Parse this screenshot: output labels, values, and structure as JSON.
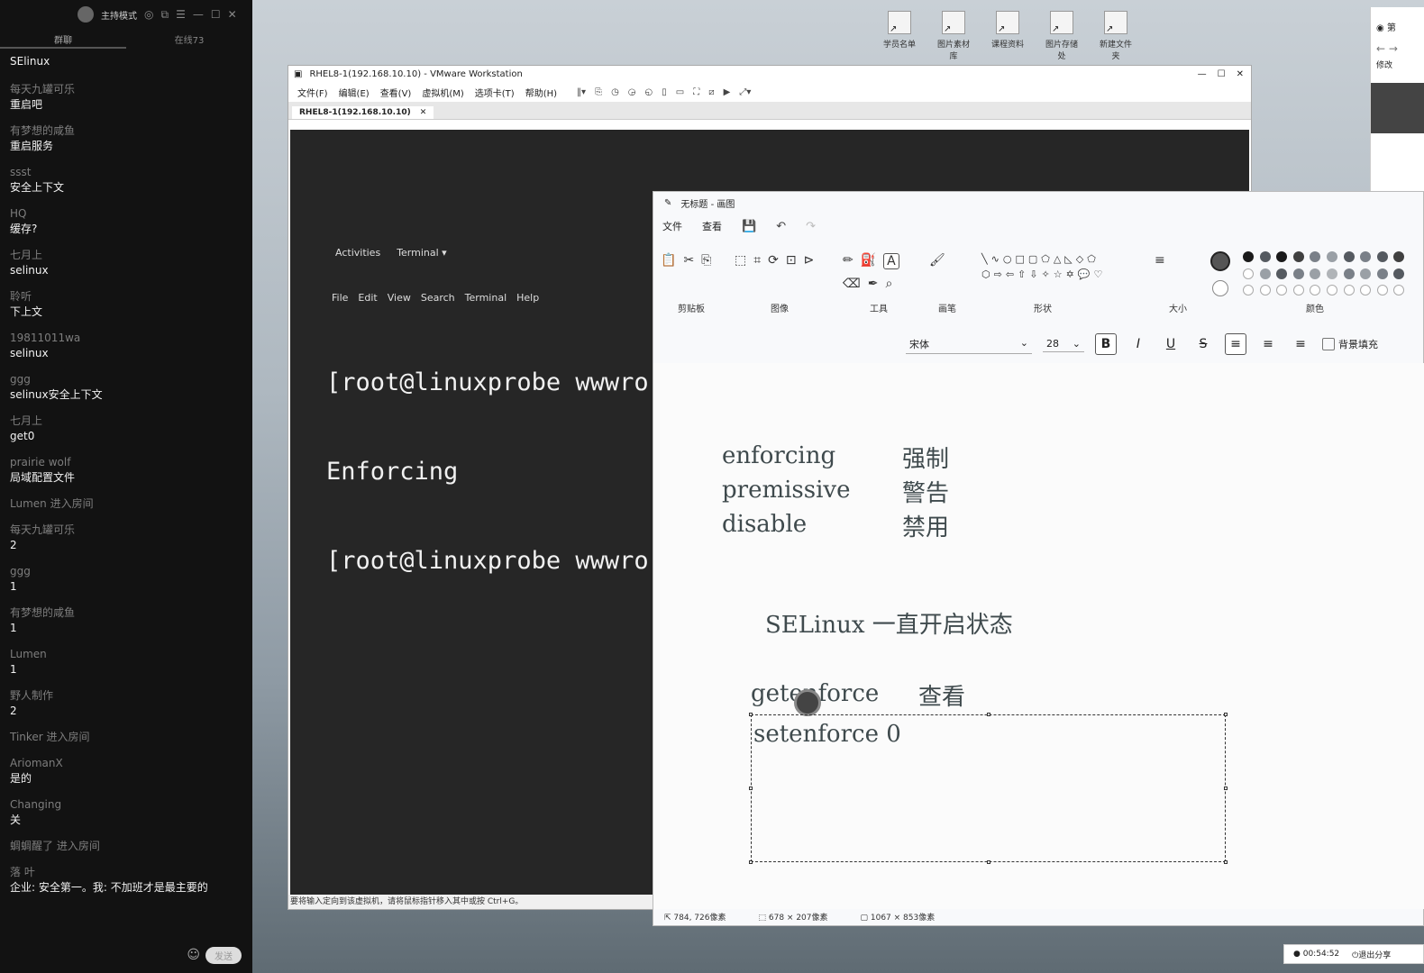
{
  "chat": {
    "title": "主持模式",
    "tabs": [
      "群聊",
      "在线73"
    ],
    "messages": [
      {
        "user": "",
        "text": "SElinux"
      },
      {
        "user": "每天九罐可乐",
        "text": "重启吧"
      },
      {
        "user": "有梦想的咸鱼",
        "text": "重启服务"
      },
      {
        "user": "ssst",
        "text": "安全上下文"
      },
      {
        "user": "HQ",
        "text": "缓存?"
      },
      {
        "user": "七月上",
        "text": "selinux"
      },
      {
        "user": "聆听",
        "text": "下上文"
      },
      {
        "user": "19811011wa",
        "text": "selinux"
      },
      {
        "user": "ggg",
        "text": "selinux安全上下文"
      },
      {
        "user": "七月上",
        "text": "get0"
      },
      {
        "user": "prairie wolf",
        "text": "局域配置文件"
      },
      {
        "user": "Lumen 进入房间",
        "text": ""
      },
      {
        "user": "每天九罐可乐",
        "text": "2"
      },
      {
        "user": "ggg",
        "text": "1"
      },
      {
        "user": "有梦想的咸鱼",
        "text": "1"
      },
      {
        "user": "Lumen",
        "text": "1"
      },
      {
        "user": "野人制作",
        "text": "2"
      },
      {
        "user": "Tinker 进入房间",
        "text": ""
      },
      {
        "user": "AriomanX",
        "text": "是的"
      },
      {
        "user": "Changing",
        "text": "关"
      },
      {
        "user": "蜩蜩醒了 进入房间",
        "text": ""
      },
      {
        "user": "落 叶",
        "text": "企业: 安全第一。我: 不加班才是最主要的"
      }
    ],
    "send_label": "发送"
  },
  "desktop_icons": [
    "学员名单",
    "图片素材库",
    "课程资料",
    "图片存储处",
    "新建文件夹"
  ],
  "vmware": {
    "title": "RHEL8-1(192.168.10.10) - VMware Workstation",
    "menu": [
      "文件(F)",
      "编辑(E)",
      "查看(V)",
      "虚拟机(M)",
      "选项卡(T)",
      "帮助(H)"
    ],
    "tab": "RHEL8-1(192.168.10.10)",
    "gnome_activities": "Activities",
    "gnome_terminal": "Terminal ▾",
    "terminal_menu": [
      "File",
      "Edit",
      "View",
      "Search",
      "Terminal",
      "Help"
    ],
    "terminal_lines": [
      "[root@linuxprobe wwwro",
      "Enforcing",
      "[root@linuxprobe wwwro"
    ],
    "status": "要将输入定向到该虚拟机，请将鼠标指针移入其中或按 Ctrl+G。"
  },
  "paint": {
    "title": "无标题 - 画图",
    "menu": [
      "文件",
      "查看"
    ],
    "groups": [
      "剪贴板",
      "图像",
      "工具",
      "画笔",
      "形状",
      "大小",
      "颜色"
    ],
    "font_name": "宋体",
    "font_size": "28",
    "fill_label": "背景填充",
    "canvas": {
      "mode_rows": [
        {
          "en": "enforcing",
          "zh": "强制"
        },
        {
          "en": "premissive",
          "zh": "警告"
        },
        {
          "en": "disable",
          "zh": "禁用"
        }
      ],
      "selinux_line": "SELinux 一直开启状态",
      "getenforce": "getenforce",
      "getenforce_zh": "查看",
      "setenforce": "setenforce 0"
    },
    "status": {
      "cursor": "784, 726像素",
      "selection": "678 × 207像素",
      "canvas_size": "1067 × 853像素"
    },
    "palette": [
      "#1a1a1a",
      "#555a60",
      "#1a1a1a",
      "#404040",
      "#7a8088",
      "#9aa0a6",
      "#555a60",
      "#7a8088",
      "#555a60",
      "#404040",
      "#ffffff",
      "#9aa0a6",
      "#555a60",
      "#7a8088",
      "#9aa0a6",
      "#b0b4b8",
      "#7a8088",
      "#9aa0a6",
      "#7a8088",
      "#555a60",
      "#ffffff",
      "#ffffff",
      "#ffffff",
      "#ffffff",
      "#ffffff",
      "#ffffff",
      "#ffffff",
      "#ffffff",
      "#ffffff",
      "#ffffff"
    ]
  },
  "recording": {
    "time": "00:54:52",
    "stop_label": "退出分享"
  },
  "right_window": {
    "title": "第",
    "label": "修改"
  }
}
